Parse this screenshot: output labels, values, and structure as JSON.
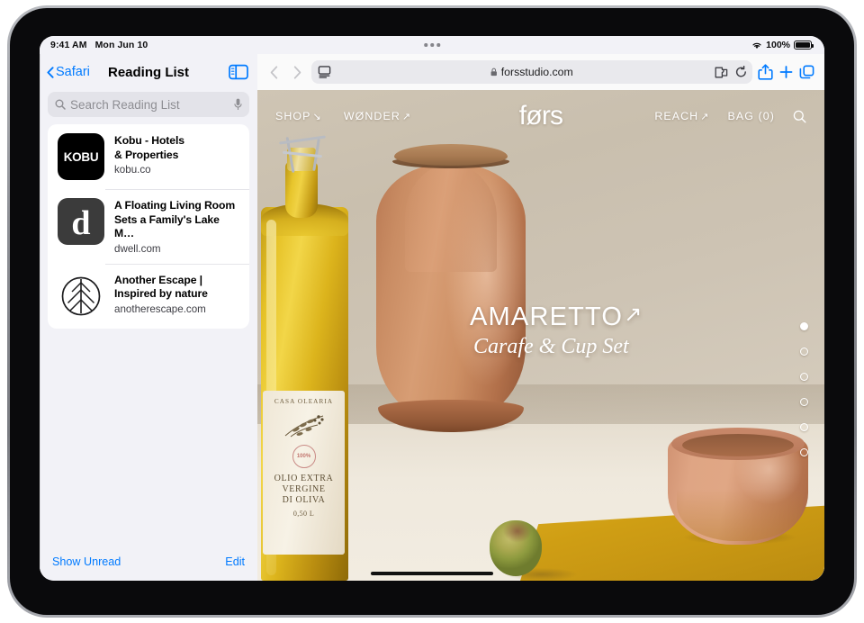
{
  "status_bar": {
    "time": "9:41 AM",
    "date": "Mon Jun 10",
    "battery_percent": "100%",
    "wifi_icon": "wifi-icon",
    "battery_icon": "battery-icon",
    "multitask_icon": "multitasking-dots-icon"
  },
  "sidebar": {
    "back_label": "Safari",
    "title": "Reading List",
    "toggle_icon": "sidebar-toggle-icon",
    "search": {
      "placeholder": "Search Reading List",
      "search_icon": "search-icon",
      "dictation_icon": "microphone-icon"
    },
    "items": [
      {
        "title": "Kobu - Hotels\n& Properties",
        "title_line1": "Kobu - Hotels",
        "title_line2": "& Properties",
        "url": "kobu.co",
        "thumb_text": "KOBU",
        "thumb_kind": "kobu"
      },
      {
        "title_line1": "A Floating Living Room",
        "title_line2": "Sets a Family's Lake M…",
        "url": "dwell.com",
        "thumb_text": "d",
        "thumb_kind": "dwell"
      },
      {
        "title_line1": "Another Escape |",
        "title_line2": "Inspired by nature",
        "url": "anotherescape.com",
        "thumb_text": "",
        "thumb_kind": "leaf-logo"
      }
    ],
    "footer": {
      "show_unread": "Show Unread",
      "edit": "Edit"
    }
  },
  "browser_toolbar": {
    "back_icon": "chevron-left-icon",
    "forward_icon": "chevron-right-icon",
    "page_settings_icon": "page-settings-aa-icon",
    "lock_icon": "lock-icon",
    "url": "forsstudio.com",
    "extensions_icon": "extensions-puzzle-icon",
    "reload_icon": "reload-icon",
    "share_icon": "share-icon",
    "new_tab_icon": "plus-icon",
    "tabs_icon": "tab-overview-icon"
  },
  "website": {
    "logo": "førs",
    "nav_left": [
      {
        "label": "SHOP",
        "arrow": "↘"
      },
      {
        "label": "WØNDER",
        "arrow": "↗"
      }
    ],
    "nav_right": [
      {
        "label": "REACH",
        "arrow": "↗"
      },
      {
        "label": "BAG (0)",
        "arrow": ""
      }
    ],
    "search_icon": "search-icon",
    "hero": {
      "title": "AMARETTO",
      "title_arrow": "↗",
      "subtitle": "Carafe & Cup Set"
    },
    "carousel": {
      "total_dots": 6,
      "active_index": 0
    },
    "product_label": {
      "brand": "CASA OLEARIA",
      "seal": "100%",
      "line1": "OLIO EXTRA",
      "line2": "VERGINE",
      "line3": "DI OLIVA",
      "volume": "0,50 L"
    }
  },
  "colors": {
    "accent_blue": "#007aff",
    "sidebar_bg": "#f2f2f7",
    "wall": "#cdc3b3",
    "terracotta": "#d09272",
    "cloth_gold": "#cf9e14"
  },
  "home_indicator": "home-indicator"
}
